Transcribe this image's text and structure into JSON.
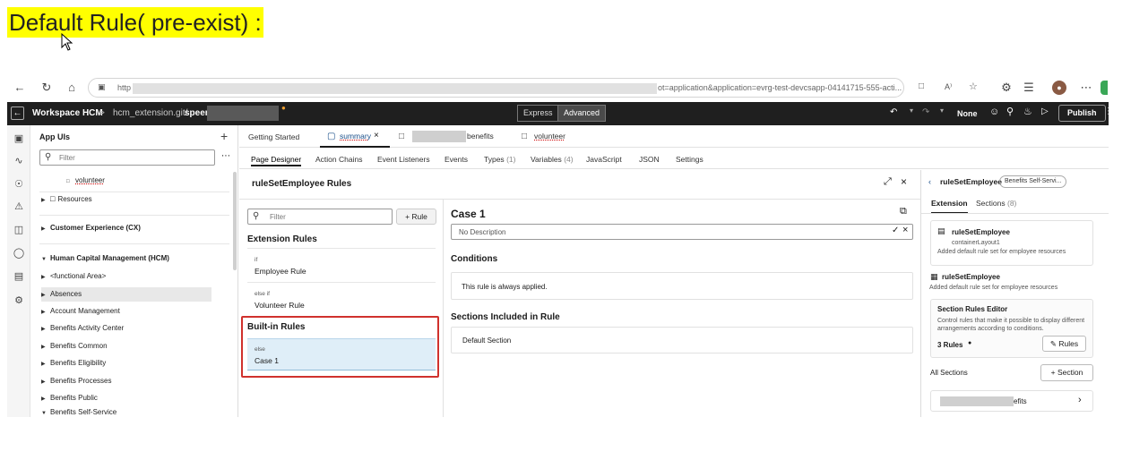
{
  "heading": "Default Rule( pre-exist) :",
  "browser": {
    "url_start": "http",
    "url_end": "ot=application&application=evrg-test-devcsapp-04141715-555-acti..."
  },
  "app_header": {
    "workspace": "Workspace HCM",
    "sep": ">",
    "repo": "hcm_extension.git/",
    "branch": "speer",
    "express_label": "Express",
    "advanced_label": "Advanced",
    "none_label": "None",
    "publish_label": "Publish"
  },
  "app_uis": {
    "title": "App UIs",
    "filter_placeholder": "Filter",
    "items": {
      "volunteer": "volunteer",
      "resources": "Resources",
      "cx": "Customer Experience (CX)",
      "hcm": "Human Capital Management (HCM)",
      "functional": "<functional Area>",
      "absences": "Absences",
      "account": "Account Management",
      "bac": "Benefits Activity Center",
      "common": "Benefits Common",
      "elig": "Benefits Eligibility",
      "proc": "Benefits Processes",
      "public": "Benefits Public",
      "selfservice": "Benefits Self-Service"
    }
  },
  "tabs": {
    "getting_started": "Getting Started",
    "summary": "summary",
    "benefits": "benefits",
    "volunteer": "volunteer"
  },
  "subtabs": {
    "page_designer": "Page Designer",
    "action_chains": "Action Chains",
    "event_listeners": "Event Listeners",
    "events": "Events",
    "types": "Types",
    "types_count": "(1)",
    "variables": "Variables",
    "variables_count": "(4)",
    "javascript": "JavaScript",
    "json": "JSON",
    "settings": "Settings"
  },
  "rules_panel": {
    "title": "ruleSetEmployee Rules",
    "filter_placeholder": "Filter",
    "add_rule": "Rule",
    "extension_rules": "Extension Rules",
    "rule1_kw": "if",
    "rule1_name": "Employee Rule",
    "rule2_kw": "else if",
    "rule2_name": "Volunteer Rule",
    "builtin_rules": "Built-in Rules",
    "builtin_kw": "else",
    "builtin_name": "Case 1"
  },
  "case_panel": {
    "title": "Case 1",
    "description": "No Description",
    "conditions_title": "Conditions",
    "conditions_text": "This rule is always applied.",
    "sections_title": "Sections Included in Rule",
    "section_name": "Default Section"
  },
  "right_panel": {
    "back_title": "ruleSetEmployee",
    "badge": "Benefits Self-Servi...",
    "tab_extension": "Extension",
    "tab_sections": "Sections",
    "tab_sections_count": "(8)",
    "card1_title": "ruleSetEmployee",
    "card1_sub": "containerLayout1",
    "card1_desc": "Added default rule set for employee resources",
    "item2_title": "ruleSetEmployee",
    "item2_desc": "Added default rule set for employee resources",
    "editor_title": "Section Rules Editor",
    "editor_desc": "Control rules that make it possible to display different arrangements according to conditions.",
    "rules_count": "3 Rules",
    "rules_btn": "Rules",
    "all_sections": "All Sections",
    "section_btn": "Section",
    "section_item_tail": "efits"
  },
  "colors": {
    "highlight": "#ffff00",
    "red_box": "#d0312d",
    "selected_row": "#dfeef8",
    "header_bg": "#1f1f1f"
  }
}
